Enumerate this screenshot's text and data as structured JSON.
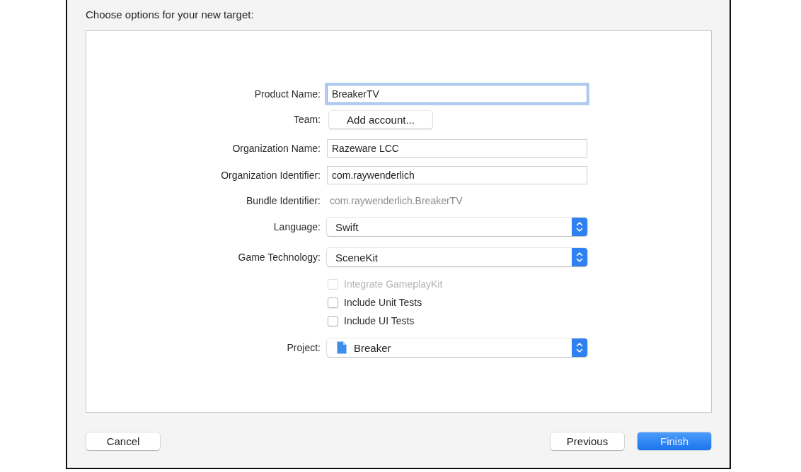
{
  "dialog": {
    "title": "Choose options for your new target:"
  },
  "form": {
    "rows": [
      {
        "kind": "text_field",
        "label": "Product Name:",
        "value": "BreakerTV",
        "focused": true
      },
      {
        "kind": "button",
        "label": "Team:",
        "button": "Add account..."
      },
      {
        "kind": "text_field",
        "label": "Organization Name:",
        "value": "Razeware LCC",
        "focused": false
      },
      {
        "kind": "text_field",
        "label": "Organization Identifier:",
        "value": "com.raywenderlich",
        "focused": false
      },
      {
        "kind": "static",
        "label": "Bundle Identifier:",
        "value": "com.raywenderlich.BreakerTV"
      },
      {
        "kind": "popup",
        "label": "Language:",
        "value": "Swift",
        "icon": false
      },
      {
        "kind": "popup",
        "label": "Game Technology:",
        "value": "SceneKit",
        "icon": false
      },
      {
        "kind": "checkbox",
        "label": "Integrate GameplayKit",
        "checked": false,
        "disabled": true
      },
      {
        "kind": "checkbox",
        "label": "Include Unit Tests",
        "checked": false,
        "disabled": false
      },
      {
        "kind": "checkbox",
        "label": "Include UI Tests",
        "checked": false,
        "disabled": false
      },
      {
        "kind": "popup",
        "label": "Project:",
        "value": "Breaker",
        "icon": true
      }
    ]
  },
  "footer": {
    "left": [
      {
        "label": "Cancel",
        "default": false
      }
    ],
    "right": [
      {
        "label": "Previous",
        "default": false
      },
      {
        "label": "Finish",
        "default": true
      }
    ]
  }
}
